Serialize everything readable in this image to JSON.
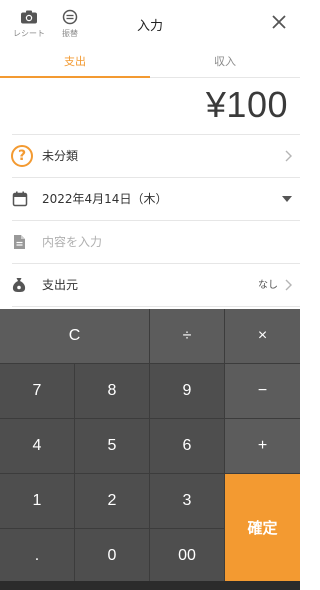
{
  "header": {
    "receipt_label": "レシート",
    "transfer_label": "振替",
    "title": "入力"
  },
  "tabs": [
    {
      "label": "支出",
      "active": true
    },
    {
      "label": "収入",
      "active": false
    }
  ],
  "amount": "¥100",
  "rows": {
    "category": "未分類",
    "date": "2022年4月14日（木）",
    "memo_placeholder": "内容を入力",
    "source_label": "支出元",
    "source_value": "なし"
  },
  "keypad": {
    "clear": "C",
    "divide": "÷",
    "multiply": "×",
    "minus": "−",
    "plus": "+",
    "confirm": "確定",
    "digits": [
      "7",
      "8",
      "9",
      "4",
      "5",
      "6",
      "1",
      "2",
      "3",
      ".",
      "0",
      "00"
    ]
  },
  "colors": {
    "accent": "#f39a31",
    "keypad_bg": "#4e4e4e",
    "operator_bg": "#5c5c5c"
  },
  "icons": {
    "receipt": "camera-icon",
    "transfer": "transfer-icon",
    "close": "close-icon",
    "category": "question-circle-icon",
    "date": "calendar-icon",
    "memo": "document-icon",
    "source": "money-bag-icon"
  }
}
